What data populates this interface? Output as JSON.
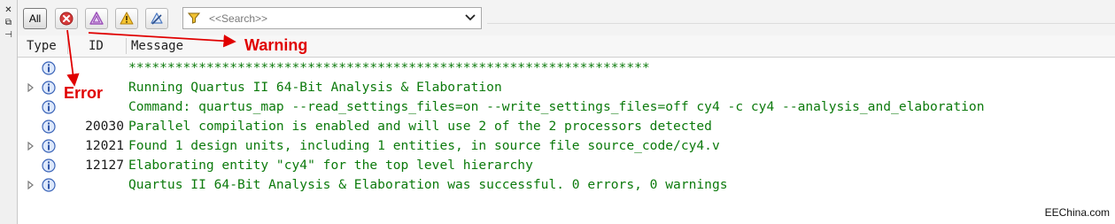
{
  "dock": {
    "close_glyph": "✕",
    "float_glyph": "⧉",
    "pin_glyph": "⊣"
  },
  "toolbar": {
    "all_label": "All",
    "filter_buttons": [
      {
        "icon": "error-filter-icon",
        "color": "#d63b3b"
      },
      {
        "icon": "critical-warning-filter-icon",
        "color": "#9a4fb8"
      },
      {
        "icon": "warning-filter-icon",
        "color": "#e0a020"
      },
      {
        "icon": "suppressed-filter-icon",
        "color": "#4a78c0"
      }
    ]
  },
  "search": {
    "placeholder": "<<Search>>",
    "icon": "funnel-icon"
  },
  "columns": {
    "type": "Type",
    "id": "ID",
    "message": "Message"
  },
  "rows": [
    {
      "expandable": false,
      "id": "",
      "message": "*******************************************************************"
    },
    {
      "expandable": true,
      "id": "",
      "message": "Running Quartus II 64-Bit Analysis & Elaboration"
    },
    {
      "expandable": false,
      "id": "",
      "message": "Command: quartus_map --read_settings_files=on --write_settings_files=off cy4 -c cy4 --analysis_and_elaboration"
    },
    {
      "expandable": false,
      "id": "20030",
      "message": "Parallel compilation is enabled and will use 2 of the 2 processors detected"
    },
    {
      "expandable": true,
      "id": "12021",
      "message": "Found 1 design units, including 1 entities, in source file source_code/cy4.v"
    },
    {
      "expandable": false,
      "id": "12127",
      "message": "Elaborating entity \"cy4\" for the top level hierarchy"
    },
    {
      "expandable": true,
      "id": "",
      "message": "Quartus II 64-Bit Analysis & Elaboration was successful. 0 errors, 0 warnings"
    }
  ],
  "annotations": {
    "warning_label": "Warning",
    "error_label": "Error",
    "color": "#e00000"
  },
  "watermark": "EEChina.com"
}
